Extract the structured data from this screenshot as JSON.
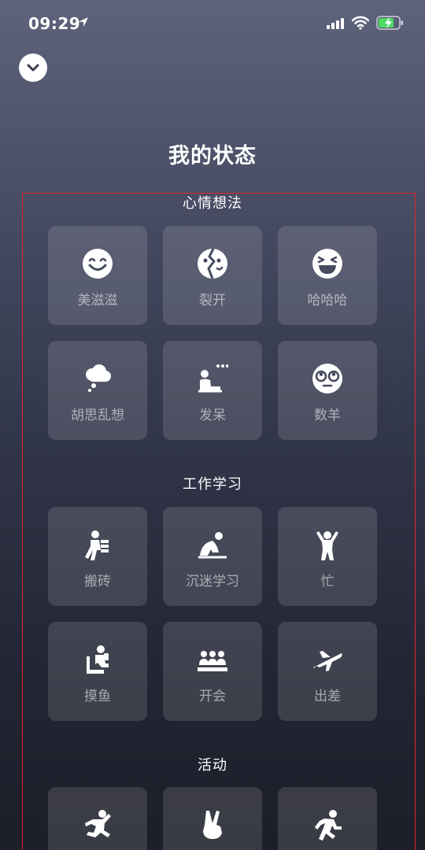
{
  "status_bar": {
    "time": "09:29"
  },
  "header": {
    "title": "我的状态"
  },
  "sections": [
    {
      "title": "心情想法",
      "items": [
        {
          "label": "美滋滋",
          "icon": "smiley-icon"
        },
        {
          "label": "裂开",
          "icon": "cracked-face-icon"
        },
        {
          "label": "哈哈哈",
          "icon": "laughing-face-icon"
        },
        {
          "label": "胡思乱想",
          "icon": "thought-cloud-icon"
        },
        {
          "label": "发呆",
          "icon": "daze-person-icon"
        },
        {
          "label": "数羊",
          "icon": "sleepy-face-icon"
        }
      ]
    },
    {
      "title": "工作学习",
      "items": [
        {
          "label": "搬砖",
          "icon": "carry-bricks-icon"
        },
        {
          "label": "沉迷学习",
          "icon": "studying-person-icon"
        },
        {
          "label": "忙",
          "icon": "busy-person-icon"
        },
        {
          "label": "摸鱼",
          "icon": "slacking-person-icon"
        },
        {
          "label": "开会",
          "icon": "meeting-icon"
        },
        {
          "label": "出差",
          "icon": "airplane-icon"
        }
      ]
    },
    {
      "title": "活动",
      "items": [
        {
          "label": "",
          "icon": "jumping-person-icon"
        },
        {
          "label": "",
          "icon": "victory-hand-icon"
        },
        {
          "label": "",
          "icon": "running-person-icon"
        }
      ]
    }
  ]
}
